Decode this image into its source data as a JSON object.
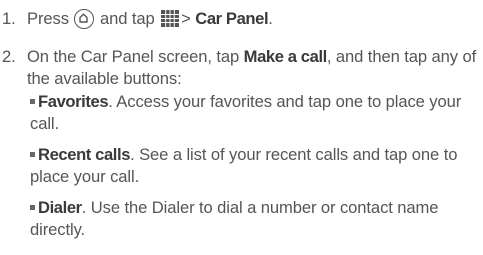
{
  "steps": [
    {
      "number": "1.",
      "text_press": "Press",
      "icon_home": "home-icon",
      "text_and_tap": "and tap",
      "icon_apps": "apps-grid-icon",
      "text_sep": ">",
      "bold_target": "Car Panel",
      "text_end": "."
    },
    {
      "number": "2.",
      "text_before": "On the Car Panel screen, tap",
      "bold_action": "Make a call",
      "text_after": ", and then tap any of the available buttons:",
      "bullets": [
        {
          "label": "Favorites",
          "description": ". Access your favorites and tap one to place your call."
        },
        {
          "label": "Recent calls",
          "description": ". See a list of your recent calls and tap one to place your call."
        },
        {
          "label": "Dialer",
          "description": ". Use the Dialer to dial a number or contact name directly."
        }
      ]
    }
  ]
}
